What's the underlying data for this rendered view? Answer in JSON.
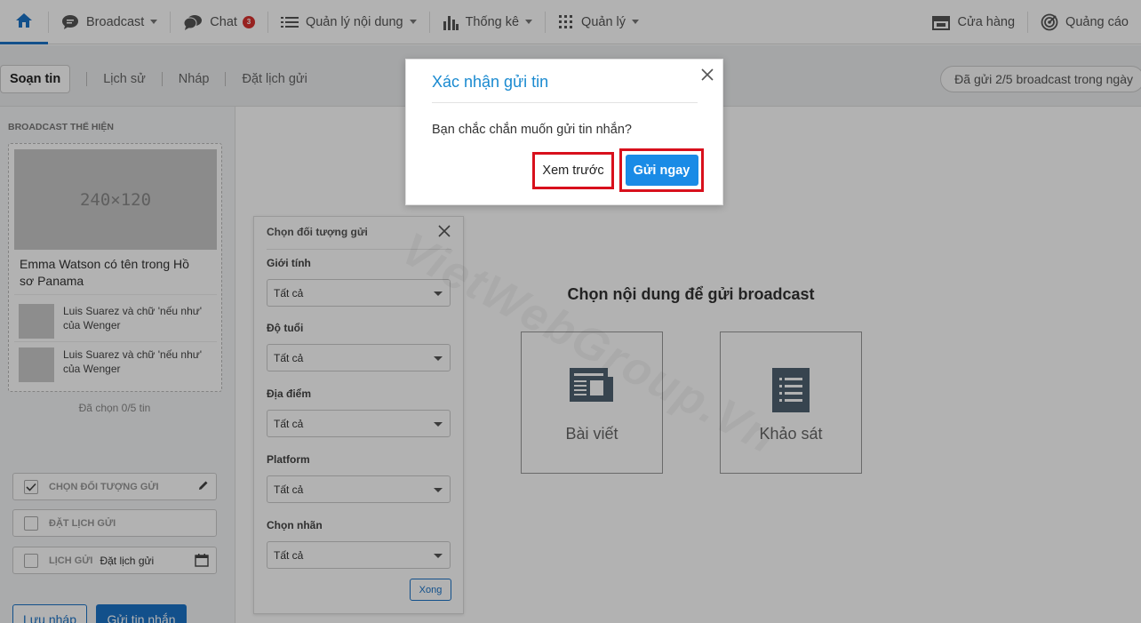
{
  "nav": {
    "broadcast": "Broadcast",
    "chat": "Chat",
    "chat_badge": "3",
    "content": "Quản lý nội dung",
    "stats": "Thống kê",
    "manage": "Quản lý",
    "store": "Cửa hàng",
    "ads": "Quảng cáo"
  },
  "subtabs": {
    "compose": "Soạn tin",
    "history": "Lịch sử",
    "draft": "Nháp",
    "schedule": "Đặt lịch gửi"
  },
  "quota": "Đã gửi 2/5 broadcast trong ngày",
  "sidebar": {
    "heading": "BROADCAST THỂ HIỆN",
    "placeholder": "240×120",
    "main_title": "Emma Watson có tên trong Hồ sơ Panama",
    "sub_items": [
      "Luis Suarez và chữ 'nếu như' của Wenger",
      "Luis Suarez và chữ 'nếu như' của Wenger"
    ],
    "chosen_count": "Đã chọn 0/5 tin",
    "opt_audience": "CHỌN ĐỐI TƯỢNG GỬI",
    "opt_schedule": "ĐẶT LỊCH GỬI",
    "opt_sched_label": "LỊCH GỬI",
    "opt_sched_value": "Đặt lịch gửi",
    "save_draft": "Lưu nháp",
    "send": "Gửi tin nhắn"
  },
  "audience": {
    "title": "Chọn đối tượng gửi",
    "fields": [
      {
        "label": "Giới tính",
        "value": "Tất cả"
      },
      {
        "label": "Độ tuổi",
        "value": "Tất cả"
      },
      {
        "label": "Địa điểm",
        "value": "Tất cả"
      },
      {
        "label": "Platform",
        "value": "Tất cả"
      },
      {
        "label": "Chọn nhãn",
        "value": "Tất cả"
      }
    ],
    "done": "Xong"
  },
  "main": {
    "title": "Chọn nội dung để gửi broadcast",
    "card_article": "Bài viết",
    "card_survey": "Khảo sát"
  },
  "watermark": "VietWebGroup.Vn",
  "modal": {
    "title": "Xác nhận gửi tin",
    "message": "Bạn chắc chắn muốn gửi tin nhắn?",
    "preview": "Xem trước",
    "send_now": "Gửi ngay"
  },
  "colors": {
    "primary": "#1a73c8",
    "highlight": "#d8101c",
    "modal_title": "#1a8ad0"
  }
}
